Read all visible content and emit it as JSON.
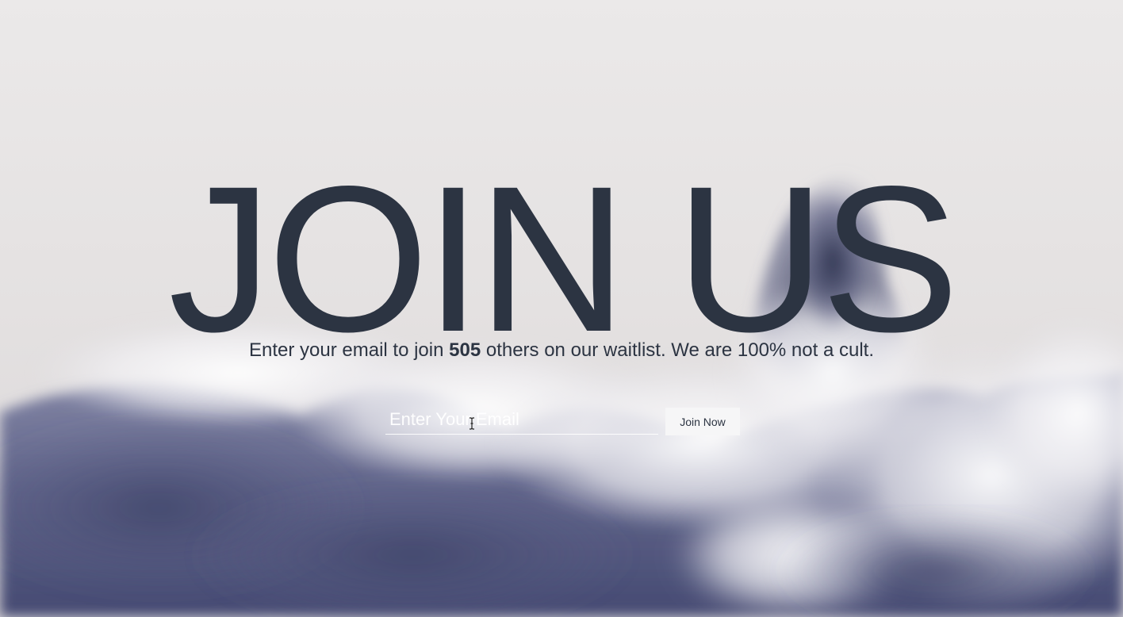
{
  "hero": {
    "title": "JOIN US"
  },
  "subtitle": {
    "prefix": "Enter your email to join ",
    "count": "505",
    "suffix": " others on our waitlist. We are 100% not a cult."
  },
  "form": {
    "email_placeholder": "Enter Your Email",
    "email_value": "",
    "submit_label": "Join Now"
  },
  "icons": {
    "cursor": "text-cursor-icon"
  },
  "colors": {
    "text": "#2c3442",
    "button_bg": "#f6f6f7",
    "input_text": "#ffffff"
  }
}
